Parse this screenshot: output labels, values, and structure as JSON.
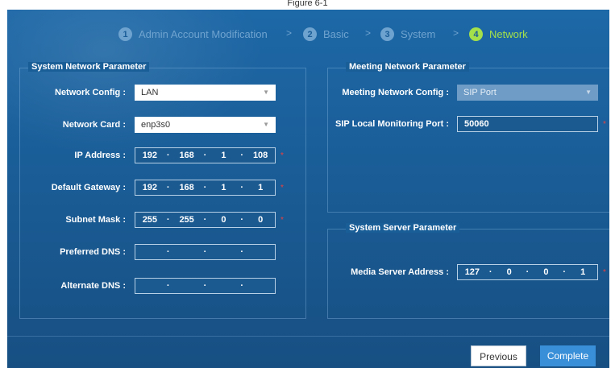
{
  "top_title": "Figure 6-1",
  "steps": [
    {
      "num": "1",
      "label": "Admin Account Modification"
    },
    {
      "num": "2",
      "label": "Basic"
    },
    {
      "num": "3",
      "label": "System"
    },
    {
      "num": "4",
      "label": "Network"
    }
  ],
  "step_separator": ">",
  "system_network": {
    "legend": "System Network Parameter",
    "network_config_label": "Network Config :",
    "network_config_value": "LAN",
    "network_card_label": "Network Card :",
    "network_card_value": "enp3s0",
    "ip_label": "IP Address :",
    "ip": [
      "192",
      "168",
      "1",
      "108"
    ],
    "gateway_label": "Default Gateway :",
    "gateway": [
      "192",
      "168",
      "1",
      "1"
    ],
    "subnet_label": "Subnet Mask :",
    "subnet": [
      "255",
      "255",
      "0",
      "0"
    ],
    "preferred_dns_label": "Preferred DNS :",
    "alternate_dns_label": "Alternate DNS :"
  },
  "meeting_network": {
    "legend": "Meeting Network Parameter",
    "config_label": "Meeting Network Config :",
    "config_value": "SIP Port",
    "sip_label": "SIP Local Monitoring Port :",
    "sip_value": "50060"
  },
  "system_server": {
    "legend": "System Server Parameter",
    "media_label": "Media Server Address :",
    "media": [
      "127",
      "0",
      "0",
      "1"
    ]
  },
  "required_mark": "*",
  "ip_dot": "·",
  "caret": "▼",
  "buttons": {
    "previous": "Previous",
    "complete": "Complete"
  }
}
